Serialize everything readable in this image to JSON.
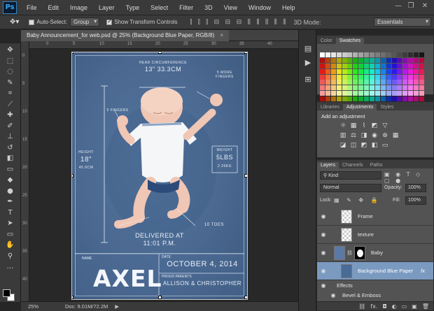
{
  "app": {
    "logo": "Ps"
  },
  "menu": [
    "File",
    "Edit",
    "Image",
    "Layer",
    "Type",
    "Select",
    "Filter",
    "3D",
    "View",
    "Window",
    "Help"
  ],
  "window_controls": {
    "minimize": "—",
    "restore": "❐",
    "close": "✕"
  },
  "options_bar": {
    "auto_select_label": "Auto-Select:",
    "auto_select_checked": false,
    "auto_select_target": "Group",
    "show_transform_label": "Show Transform Controls",
    "show_transform_checked": true,
    "workspace": "Essentials"
  },
  "document": {
    "tab_title": "Baby Announcement_for web.psd @ 25% (Background Blue Paper, RGB/8)",
    "tab_close": "×"
  },
  "ruler_h": [
    "0",
    "5",
    "10",
    "15",
    "20",
    "25",
    "30",
    "35",
    "40"
  ],
  "ruler_v": [
    "0",
    "5",
    "10",
    "15",
    "20",
    "25",
    "30",
    "35",
    "40"
  ],
  "canvas_text": {
    "head_label": "HEAD CIRCUMFERENCE",
    "head_value": "13\" 33.3CM",
    "fingers_right": "5 MORE FINGERS",
    "fingers_left": "5 FINGERS",
    "height_label": "HEIGHT",
    "height_value": "18\"",
    "height_cm": "45.9CM",
    "weight_label": "WEIGHT",
    "weight_value": "5LBS",
    "weight_sub": "2.26KG",
    "delivered": "DELIVERED AT",
    "delivered_time": "11:01 P.M.",
    "toes": "10 TOES",
    "name_label": "NAME",
    "name": "AXEL",
    "date_label": "DATE",
    "date": "OCTOBER 4, 2014",
    "parents_label": "PROUD PARENTS",
    "parents": "ALLISON & CHRISTOPHER"
  },
  "status": {
    "zoom": "25%",
    "doc": "Doc: 9.01M/72.2M"
  },
  "swatch_panel": {
    "tabs": [
      "Color",
      "Swatches"
    ],
    "active": "Swatches"
  },
  "adjustments_panel": {
    "tabs": [
      "Libraries",
      "Adjustments",
      "Styles"
    ],
    "active": "Adjustments",
    "title": "Add an adjustment"
  },
  "layers_panel": {
    "tabs": [
      "Layers",
      "Channels",
      "Paths"
    ],
    "active": "Layers",
    "filter_kind": "Kind",
    "blend_mode": "Normal",
    "opacity_label": "Opacity:",
    "opacity": "100%",
    "lock_label": "Lock:",
    "fill_label": "Fill:",
    "fill": "100%",
    "layers": [
      {
        "name": "Frame"
      },
      {
        "name": "texture"
      },
      {
        "name": "Baby"
      },
      {
        "name": "Background Blue Paper",
        "fx": "fx"
      }
    ],
    "effects_label": "Effects",
    "effect_item": "Bevel & Emboss",
    "footer_fx": "fx."
  }
}
